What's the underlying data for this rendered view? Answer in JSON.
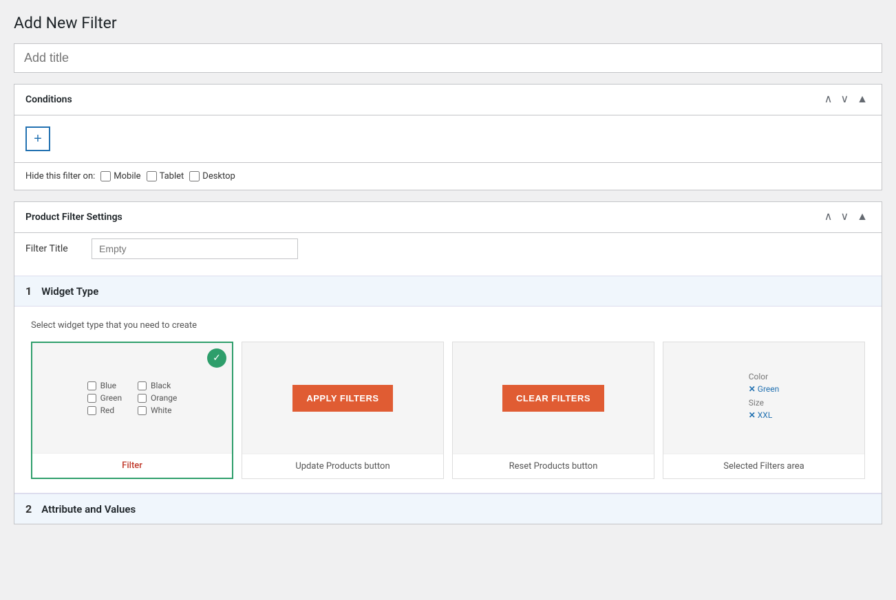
{
  "page": {
    "title": "Add New Filter"
  },
  "title_input": {
    "placeholder": "Add title",
    "value": ""
  },
  "conditions_section": {
    "title": "Conditions",
    "add_button_label": "+",
    "hide_filter_label": "Hide this filter on:",
    "checkboxes": [
      {
        "label": "Mobile",
        "checked": false
      },
      {
        "label": "Tablet",
        "checked": false
      },
      {
        "label": "Desktop",
        "checked": false
      }
    ]
  },
  "product_filter_section": {
    "title": "Product Filter Settings",
    "filter_title_label": "Filter Title",
    "filter_title_placeholder": "Empty",
    "filter_title_value": ""
  },
  "widget_type_section": {
    "number": "1",
    "title": "Widget Type",
    "hint": "Select widget type that you need to create",
    "cards": [
      {
        "id": "filter",
        "label": "Filter",
        "selected": true,
        "preview_type": "filter",
        "checkboxes": [
          {
            "label": "Blue",
            "col": 0
          },
          {
            "label": "Green",
            "col": 0
          },
          {
            "label": "Red",
            "col": 0
          },
          {
            "label": "Black",
            "col": 1
          },
          {
            "label": "Orange",
            "col": 1
          },
          {
            "label": "White",
            "col": 1
          }
        ]
      },
      {
        "id": "update-products",
        "label": "Update Products button",
        "selected": false,
        "preview_type": "apply",
        "button_text": "APPLY FILTERS"
      },
      {
        "id": "reset-products",
        "label": "Reset Products button",
        "selected": false,
        "preview_type": "clear",
        "button_text": "CLEAR FILTERS"
      },
      {
        "id": "selected-filters",
        "label": "Selected Filters area",
        "selected": false,
        "preview_type": "selected",
        "color_label": "Color",
        "color_value": "Green",
        "size_label": "Size",
        "size_value": "XXL"
      }
    ]
  },
  "attribute_section": {
    "number": "2",
    "title": "Attribute and Values"
  },
  "icons": {
    "chevron_up": "∧",
    "chevron_down": "∨",
    "triangle_up": "▲",
    "checkmark": "✓",
    "x_mark": "✕"
  }
}
